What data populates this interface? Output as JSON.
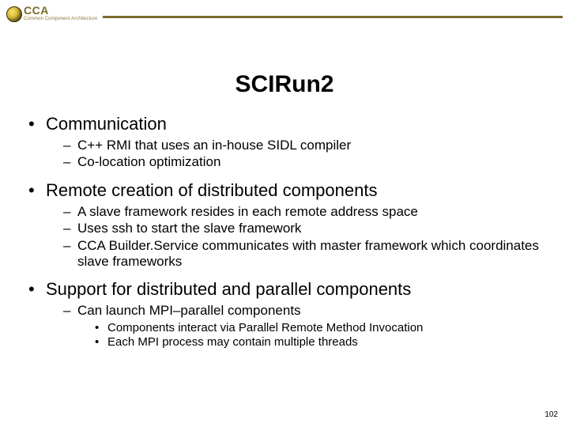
{
  "header": {
    "logo_main": "CCA",
    "logo_sub": "Common Component Architecture"
  },
  "title": "SCIRun2",
  "bullets": [
    {
      "text": "Communication",
      "sub": [
        {
          "text": "C++ RMI that uses an in-house SIDL compiler"
        },
        {
          "text": "Co-location optimization"
        }
      ]
    },
    {
      "text": "Remote creation of distributed components",
      "sub": [
        {
          "text": "A slave framework resides in each remote address space"
        },
        {
          "text": "Uses ssh to start the slave framework"
        },
        {
          "text": "CCA Builder.Service communicates with master framework which coordinates slave frameworks"
        }
      ]
    },
    {
      "text": "Support for distributed and parallel components",
      "sub": [
        {
          "text": "Can launch MPI–parallel components",
          "sub": [
            {
              "text": "Components interact via Parallel Remote Method Invocation"
            },
            {
              "text": "Each MPI process may contain multiple threads"
            }
          ]
        }
      ]
    }
  ],
  "page_number": "102"
}
